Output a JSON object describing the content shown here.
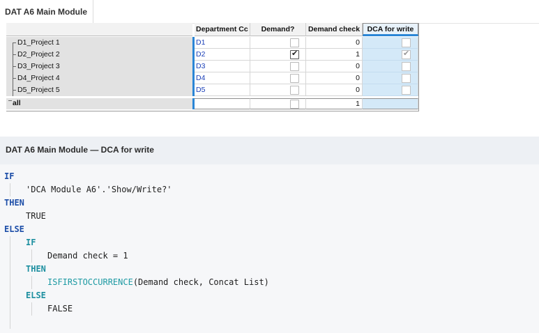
{
  "tab": {
    "title": "DAT A6 Main Module"
  },
  "grid": {
    "columns": [
      "Department Cc",
      "Demand?",
      "Demand check",
      "DCA for write"
    ],
    "rows": [
      {
        "label": "D1_Project 1",
        "department": "D1",
        "demand": false,
        "demand_check": "0",
        "dca_for_write": false
      },
      {
        "label": "D2_Project 2",
        "department": "D2",
        "demand": true,
        "demand_check": "1",
        "dca_for_write": true
      },
      {
        "label": "D3_Project 3",
        "department": "D3",
        "demand": false,
        "demand_check": "0",
        "dca_for_write": false
      },
      {
        "label": "D4_Project 4",
        "department": "D4",
        "demand": false,
        "demand_check": "0",
        "dca_for_write": false
      },
      {
        "label": "D5_Project 5",
        "department": "D5",
        "demand": false,
        "demand_check": "0",
        "dca_for_write": false
      }
    ],
    "total": {
      "label": "all",
      "demand": false,
      "demand_check": "1"
    }
  },
  "formula": {
    "title": "DAT A6 Main Module — DCA for write",
    "lines": [
      {
        "indent": 0,
        "tokens": [
          {
            "t": "IF",
            "c": "kw"
          }
        ]
      },
      {
        "indent": 1,
        "tokens": [
          {
            "t": "'DCA Module A6'.'Show/Write?'",
            "c": ""
          }
        ]
      },
      {
        "indent": 0,
        "tokens": [
          {
            "t": "THEN",
            "c": "kw"
          }
        ]
      },
      {
        "indent": 1,
        "tokens": [
          {
            "t": "TRUE",
            "c": ""
          }
        ]
      },
      {
        "indent": 0,
        "tokens": [
          {
            "t": "ELSE",
            "c": "kw"
          }
        ]
      },
      {
        "indent": 1,
        "tokens": [
          {
            "t": "IF",
            "c": "kw2"
          }
        ]
      },
      {
        "indent": 2,
        "tokens": [
          {
            "t": "Demand check = 1",
            "c": ""
          }
        ]
      },
      {
        "indent": 1,
        "tokens": [
          {
            "t": "THEN",
            "c": "kw2"
          }
        ]
      },
      {
        "indent": 2,
        "tokens": [
          {
            "t": "ISFIRSTOCCURRENCE",
            "c": "fn"
          },
          {
            "t": "(Demand check, Concat List)",
            "c": ""
          }
        ]
      },
      {
        "indent": 1,
        "tokens": [
          {
            "t": "ELSE",
            "c": "kw2"
          }
        ]
      },
      {
        "indent": 2,
        "tokens": [
          {
            "t": "FALSE",
            "c": ""
          }
        ]
      }
    ]
  },
  "icons": {
    "checkbox_checked": "check-mark-icon",
    "checkbox_empty": "empty-checkbox-icon"
  },
  "colors": {
    "accent_blue": "#2b86d6",
    "dept_text": "#1a3fb8",
    "dca_fill": "#d4e9f8",
    "keyword": "#1d4ea8",
    "function": "#1d9aa3"
  }
}
